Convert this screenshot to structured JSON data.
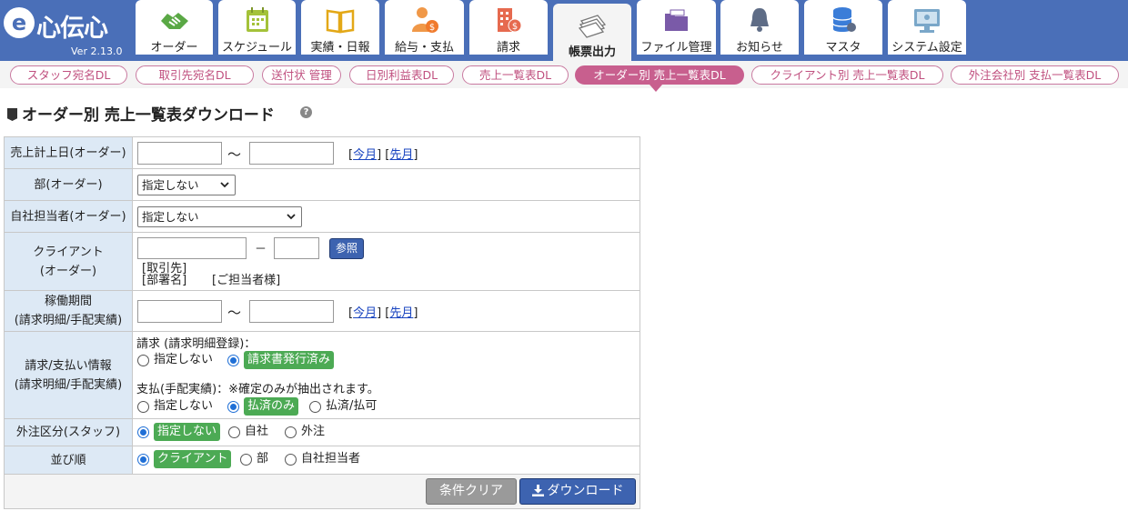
{
  "app": {
    "logo_text": "心伝心",
    "logo_mark": "e",
    "version": "Ver 2.13.0"
  },
  "colors": {
    "header_bg": "#4a6fb8",
    "accent_pink": "#c85f8e",
    "label_bg": "#dde9f5",
    "selected_green": "#4caa54",
    "button_blue": "#3d63b0"
  },
  "tabs": [
    {
      "label": "オーダー",
      "icon": "handshake-icon"
    },
    {
      "label": "スケジュール",
      "icon": "calendar-icon"
    },
    {
      "label": "実績・日報",
      "icon": "book-icon"
    },
    {
      "label": "給与・支払",
      "icon": "person-money-icon"
    },
    {
      "label": "請求",
      "icon": "building-money-icon"
    },
    {
      "label": "帳票出力",
      "icon": "papers-icon",
      "active": true
    },
    {
      "label": "ファイル管理",
      "icon": "folder-icon"
    },
    {
      "label": "お知らせ",
      "icon": "bell-icon"
    },
    {
      "label": "マスタ",
      "icon": "database-icon"
    },
    {
      "label": "システム設定",
      "icon": "monitor-settings-icon"
    }
  ],
  "subnav": [
    {
      "label": "スタッフ宛名DL"
    },
    {
      "label": "取引先宛名DL"
    },
    {
      "label": "送付状 管理"
    },
    {
      "label": "日別利益表DL"
    },
    {
      "label": "売上一覧表DL"
    },
    {
      "label": "オーダー別 売上一覧表DL",
      "active": true
    },
    {
      "label": "クライアント別 売上一覧表DL"
    },
    {
      "label": "外注会社別 支払一覧表DL"
    }
  ],
  "page": {
    "title": "オーダー別 売上一覧表ダウンロード",
    "help_icon": "question-icon"
  },
  "form": {
    "sales_date": {
      "label": "売上計上日(オーダー)",
      "from": "",
      "to": "",
      "tilde": "～",
      "this_month": "今月",
      "last_month": "先月"
    },
    "department": {
      "label": "部(オーダー)",
      "selected": "指定しない"
    },
    "staff": {
      "label": "自社担当者(オーダー)",
      "selected": "指定しない"
    },
    "client": {
      "label_line1": "クライアント",
      "label_line2": "(オーダー)",
      "code": "",
      "sub_code": "",
      "dash": "－",
      "ref_button": "参照",
      "info_client": "[取引先]",
      "info_dept": "[部署名]",
      "info_person": "[ご担当者様]"
    },
    "work_period": {
      "label_line1": "稼働期間",
      "label_line2": "(請求明細/手配実績)",
      "from": "",
      "to": "",
      "tilde": "～",
      "this_month": "今月",
      "last_month": "先月"
    },
    "billing": {
      "label_line1": "請求/支払い情報",
      "label_line2": "(請求明細/手配実績)",
      "invoice_heading": "請求 (請求明細登録)：",
      "invoice_options": [
        "指定しない",
        "請求書発行済み"
      ],
      "invoice_selected": 1,
      "payment_heading": "支払(手配実績)：※確定のみが抽出されます。",
      "payment_options": [
        "指定しない",
        "払済のみ",
        "払済/払可"
      ],
      "payment_selected": 1
    },
    "outsource": {
      "label": "外注区分(スタッフ)",
      "options": [
        "指定しない",
        "自社",
        "外注"
      ],
      "selected": 0
    },
    "sort": {
      "label": "並び順",
      "options": [
        "クライアント",
        "部",
        "自社担当者"
      ],
      "selected": 0
    },
    "buttons": {
      "clear": "条件クリア",
      "download": "ダウンロード"
    }
  }
}
